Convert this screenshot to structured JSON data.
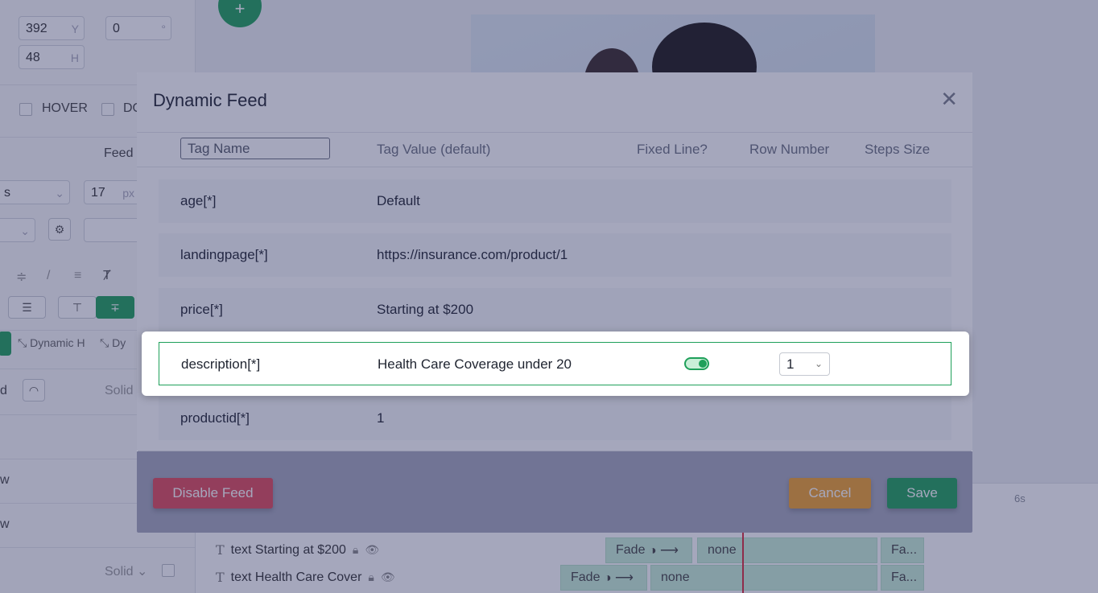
{
  "editor": {
    "position": {
      "y_value": "392",
      "y_unit": "Y",
      "rotation_value": "0",
      "rotation_unit": "°",
      "h_value": "48",
      "h_unit": "H"
    },
    "states": {
      "hover_label": "HOVER",
      "second_label": "DO"
    },
    "feed_label": "Feed",
    "font_size": {
      "value": "17",
      "unit": "px"
    },
    "font_family_partial": "s",
    "dynamic_h_label": "Dynamic H",
    "dynamic_w_partial": "Dy",
    "partial_labels": [
      "d",
      "w",
      "w"
    ],
    "solid_label": "Solid",
    "solid_label_2": "Solid",
    "plus_glyph": "+",
    "ruler_label": "6s",
    "layers": [
      {
        "name": "text Starting at $200",
        "transition_in": "Fade",
        "transition_mid": "none",
        "transition_out": "Fa..."
      },
      {
        "name": "text Health Care Cover",
        "transition_in": "Fade",
        "transition_mid": "none",
        "transition_out": "Fa..."
      }
    ]
  },
  "modal": {
    "title": "Dynamic Feed",
    "close_glyph": "✕",
    "columns": {
      "tag_name_placeholder": "Tag Name",
      "tag_value": "Tag Value (default)",
      "fixed_line": "Fixed Line?",
      "row_number": "Row Number",
      "steps_size": "Steps Size"
    },
    "rows": [
      {
        "tag": "age[*]",
        "value": "Default"
      },
      {
        "tag": "landingpage[*]",
        "value": "https://insurance.com/product/1"
      },
      {
        "tag": "price[*]",
        "value": "Starting at $200"
      },
      {
        "tag": "description[*]",
        "value": "Health Care Coverage under 20",
        "fixed_line": true,
        "row_number": "1"
      },
      {
        "tag": "productid[*]",
        "value": "1"
      }
    ],
    "buttons": {
      "disable": "Disable Feed",
      "cancel": "Cancel",
      "save": "Save"
    }
  },
  "colors": {
    "primary_green": "#1fa05a",
    "danger_red": "#e04a5a",
    "warning_orange": "#f0a02e"
  }
}
